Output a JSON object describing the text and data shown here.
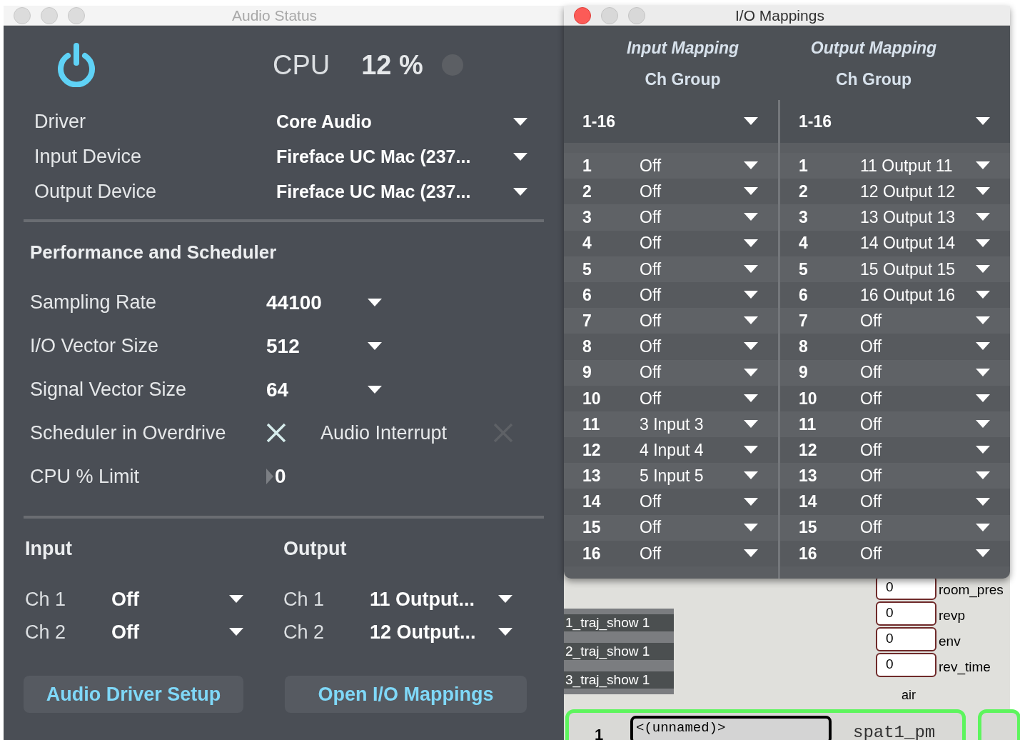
{
  "audio_status": {
    "title": "Audio Status",
    "power": {
      "on": true
    },
    "cpu_label": "CPU",
    "cpu_value": "12 %",
    "devices": [
      {
        "label": "Driver",
        "value": "Core Audio"
      },
      {
        "label": "Input Device",
        "value": "Fireface UC Mac (237..."
      },
      {
        "label": "Output Device",
        "value": "Fireface UC Mac (237..."
      }
    ],
    "section_title": "Performance and Scheduler",
    "settings": [
      {
        "label": "Sampling Rate",
        "value": "44100"
      },
      {
        "label": "I/O Vector Size",
        "value": "512"
      },
      {
        "label": "Signal Vector Size",
        "value": "64"
      }
    ],
    "toggles": [
      {
        "label": "Scheduler in Overdrive",
        "checked": true
      },
      {
        "label": "Audio Interrupt",
        "checked": false
      }
    ],
    "cpu_limit": {
      "label": "CPU % Limit",
      "value": "0"
    },
    "input": {
      "title": "Input",
      "channels": [
        {
          "label": "Ch 1",
          "value": "Off"
        },
        {
          "label": "Ch 2",
          "value": "Off"
        }
      ]
    },
    "output": {
      "title": "Output",
      "channels": [
        {
          "label": "Ch 1",
          "value": "11 Output..."
        },
        {
          "label": "Ch 2",
          "value": "12 Output..."
        }
      ]
    },
    "buttons": [
      "Audio Driver Setup",
      "Open I/O Mappings"
    ]
  },
  "io_mappings": {
    "title": "I/O Mappings",
    "columns": [
      {
        "heading": "Input Mapping",
        "subheading": "Ch Group",
        "group": "1-16",
        "rows": [
          {
            "channel": "1",
            "value": "Off"
          },
          {
            "channel": "2",
            "value": "Off"
          },
          {
            "channel": "3",
            "value": "Off"
          },
          {
            "channel": "4",
            "value": "Off"
          },
          {
            "channel": "5",
            "value": "Off"
          },
          {
            "channel": "6",
            "value": "Off"
          },
          {
            "channel": "7",
            "value": "Off"
          },
          {
            "channel": "8",
            "value": "Off"
          },
          {
            "channel": "9",
            "value": "Off"
          },
          {
            "channel": "10",
            "value": "Off"
          },
          {
            "channel": "11",
            "value": "3 Input 3"
          },
          {
            "channel": "12",
            "value": "4 Input 4"
          },
          {
            "channel": "13",
            "value": "5 Input 5"
          },
          {
            "channel": "14",
            "value": "Off"
          },
          {
            "channel": "15",
            "value": "Off"
          },
          {
            "channel": "16",
            "value": "Off"
          }
        ]
      },
      {
        "heading": "Output Mapping",
        "subheading": "Ch Group",
        "group": "1-16",
        "rows": [
          {
            "channel": "1",
            "value": "11 Output 11"
          },
          {
            "channel": "2",
            "value": "12 Output 12"
          },
          {
            "channel": "3",
            "value": "13 Output 13"
          },
          {
            "channel": "4",
            "value": "14 Output 14"
          },
          {
            "channel": "5",
            "value": "15 Output 15"
          },
          {
            "channel": "6",
            "value": "16 Output 16"
          },
          {
            "channel": "7",
            "value": "Off"
          },
          {
            "channel": "8",
            "value": "Off"
          },
          {
            "channel": "9",
            "value": "Off"
          },
          {
            "channel": "10",
            "value": "Off"
          },
          {
            "channel": "11",
            "value": "Off"
          },
          {
            "channel": "12",
            "value": "Off"
          },
          {
            "channel": "13",
            "value": "Off"
          },
          {
            "channel": "14",
            "value": "Off"
          },
          {
            "channel": "15",
            "value": "Off"
          },
          {
            "channel": "16",
            "value": "Off"
          }
        ]
      }
    ]
  },
  "patcher": {
    "messages": [
      "1_traj_show 1",
      "2_traj_show 1",
      "3_traj_show 1"
    ],
    "number_boxes": [
      {
        "value": "0",
        "label": "room_pres"
      },
      {
        "value": "0",
        "label": "revp"
      },
      {
        "value": "0",
        "label": "env"
      },
      {
        "value": "0",
        "label": "rev_time"
      }
    ],
    "caption": "air",
    "module": {
      "index": "1",
      "name_field": "<(unnamed)>",
      "name": "spat1_pm"
    }
  }
}
